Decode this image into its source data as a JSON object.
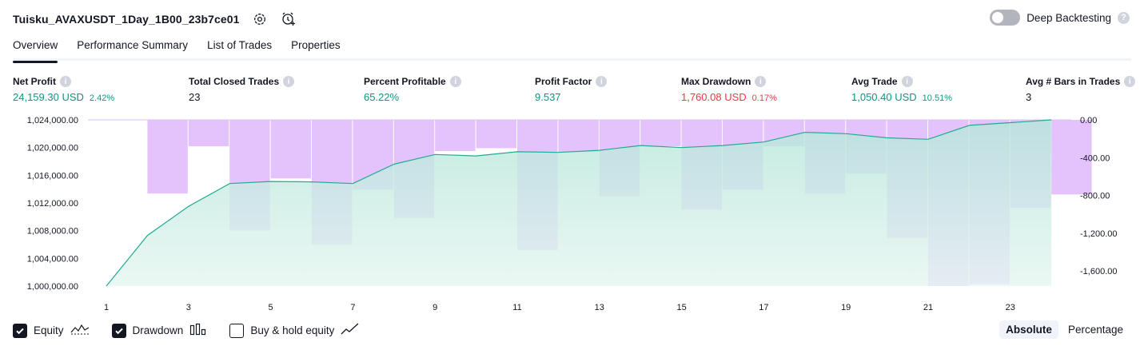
{
  "header": {
    "title": "Tuisku_AVAXUSDT_1Day_1B00_23b7ce01",
    "settings_icon": "gear-icon",
    "add_alert_icon": "alarm-plus-icon"
  },
  "deep_backtesting": {
    "label": "Deep Backtesting",
    "enabled": false,
    "help": "?"
  },
  "tabs": [
    {
      "label": "Overview",
      "active": true
    },
    {
      "label": "Performance Summary",
      "active": false
    },
    {
      "label": "List of Trades",
      "active": false
    },
    {
      "label": "Properties",
      "active": false
    }
  ],
  "metrics": {
    "net_profit": {
      "label": "Net Profit",
      "value": "24,159.30 USD",
      "pct": "2.42%"
    },
    "total_closed_trades": {
      "label": "Total Closed Trades",
      "value": "23"
    },
    "percent_profitable": {
      "label": "Percent Profitable",
      "value": "65.22%"
    },
    "profit_factor": {
      "label": "Profit Factor",
      "value": "9.537"
    },
    "max_drawdown": {
      "label": "Max Drawdown",
      "value": "1,760.08 USD",
      "pct": "0.17%"
    },
    "avg_trade": {
      "label": "Avg Trade",
      "value": "1,050.40 USD",
      "pct": "10.51%"
    },
    "avg_bars": {
      "label": "Avg # Bars in Trades",
      "value": "3"
    },
    "info_glyph": "i"
  },
  "colors": {
    "positive": "#089981",
    "negative": "#f23645",
    "equity_line": "#22ab94",
    "drawdown_bar": "#e1bdfc"
  },
  "chart_data": {
    "type": "area",
    "x_ticks": [
      "1",
      "3",
      "5",
      "7",
      "9",
      "11",
      "13",
      "15",
      "17",
      "19",
      "21",
      "23"
    ],
    "left_axis": {
      "ticks": [
        "1,024,000.00",
        "1,020,000.00",
        "1,016,000.00",
        "1,012,000.00",
        "1,008,000.00",
        "1,004,000.00",
        "1,000,000.00"
      ],
      "ylim": [
        1000000,
        1024000
      ]
    },
    "right_axis": {
      "ticks": [
        "0.00",
        "-400.00",
        "-800.00",
        "-1,200.00",
        "-1,600.00"
      ],
      "ylim": [
        -1760,
        0
      ]
    },
    "x": [
      1,
      2,
      3,
      4,
      5,
      6,
      7,
      8,
      9,
      10,
      11,
      12,
      13,
      14,
      15,
      16,
      17,
      18,
      19,
      20,
      21,
      22,
      23,
      24
    ],
    "series": [
      {
        "name": "Equity",
        "values": [
          1000000,
          1007300,
          1011500,
          1014800,
          1015100,
          1015050,
          1014800,
          1017600,
          1019000,
          1018800,
          1019400,
          1019300,
          1019600,
          1020300,
          1020000,
          1020300,
          1020800,
          1022200,
          1022000,
          1021400,
          1021200,
          1023200,
          1023600,
          1024000
        ]
      },
      {
        "name": "Drawdown",
        "values": [
          0,
          -780,
          -280,
          -1170,
          -620,
          -1320,
          -740,
          -1040,
          -330,
          -300,
          -1380,
          -340,
          -810,
          -280,
          -950,
          -740,
          -280,
          -780,
          -570,
          -1250,
          -1760,
          -1740,
          -930,
          -790
        ]
      }
    ]
  },
  "legend": {
    "items": [
      {
        "label": "Equity",
        "checked": true,
        "icon": "equity-line-icon"
      },
      {
        "label": "Drawdown",
        "checked": true,
        "icon": "drawdown-bars-icon"
      },
      {
        "label": "Buy & hold equity",
        "checked": false,
        "icon": "buy-hold-line-icon"
      }
    ]
  },
  "modes": {
    "absolute": "Absolute",
    "percentage": "Percentage",
    "active": "absolute"
  }
}
